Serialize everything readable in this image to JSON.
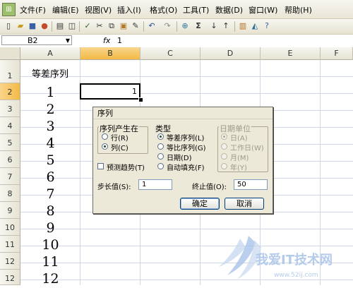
{
  "menubar": {
    "items": [
      "文件(F)",
      "编辑(E)",
      "视图(V)",
      "插入(I)",
      "格式(O)",
      "工具(T)",
      "数据(D)",
      "窗口(W)",
      "帮助(H)"
    ]
  },
  "toolbar": {
    "icons": [
      "new-icon",
      "open-icon",
      "save-icon",
      "permission-icon",
      "print-icon",
      "print-preview-icon",
      "spelling-icon",
      "cut-icon",
      "copy-icon",
      "paste-icon",
      "format-painter-icon",
      "undo-icon",
      "redo-icon",
      "hyperlink-icon",
      "autosum-icon",
      "sort-ascending-icon",
      "sort-descending-icon",
      "chart-icon",
      "drawing-icon",
      "help-icon"
    ],
    "sum_symbol": "Σ"
  },
  "formula_bar": {
    "name_box": "B2",
    "fx": "fx",
    "value": "1"
  },
  "sheet": {
    "columns": [
      "A",
      "B",
      "C",
      "D",
      "E",
      "F"
    ],
    "selected_column": "B",
    "rows": [
      "1",
      "2",
      "3",
      "4",
      "5",
      "6",
      "7",
      "8",
      "9",
      "10",
      "11",
      "12"
    ],
    "selected_row": "2",
    "a1_text": "等差序列",
    "column_a_values": [
      "1",
      "2",
      "3",
      "4",
      "5",
      "6",
      "7",
      "8",
      "9",
      "10",
      "11",
      "12"
    ],
    "active_cell_value": "1"
  },
  "dialog": {
    "title": "序列",
    "series_in": {
      "label": "序列产生在",
      "options": [
        "行(R)",
        "列(C)"
      ],
      "selected": "列(C)"
    },
    "type": {
      "label": "类型",
      "options": [
        "等差序列(L)",
        "等比序列(G)",
        "日期(D)",
        "自动填充(F)"
      ],
      "selected": "等差序列(L)"
    },
    "date_unit": {
      "label": "日期单位",
      "options": [
        "日(A)",
        "工作日(W)",
        "月(M)",
        "年(Y)"
      ],
      "selected": "日(A)",
      "disabled": true
    },
    "trend": {
      "label": "预测趋势(T)",
      "checked": false
    },
    "step_label": "步长值(S):",
    "step_value": "1",
    "stop_label": "终止值(O):",
    "stop_value": "50",
    "ok_label": "确定",
    "cancel_label": "取消"
  },
  "watermark": {
    "text": "我爱IT技术网",
    "url": "www.52ij.com"
  },
  "colors": {
    "selected_header": "#f4b946",
    "dialog_bg": "#ece9d8",
    "grid_line": "#d0d7e5",
    "watermark": "#a8c3e8"
  }
}
